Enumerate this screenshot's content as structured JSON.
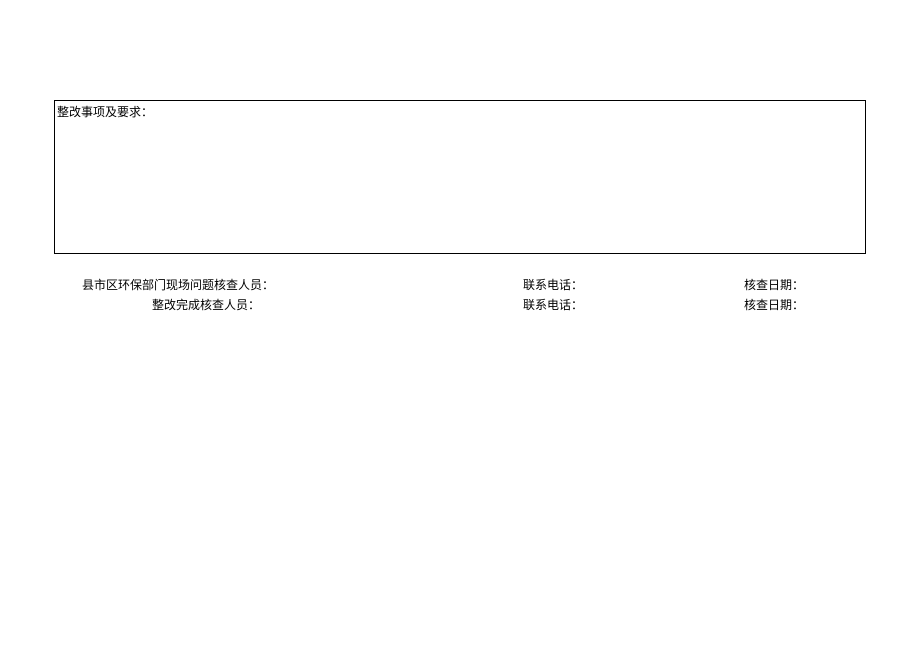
{
  "box": {
    "title": "整改事项及要求："
  },
  "signatures": {
    "row1": {
      "personnel_label": "县市区环保部门现场问题核查人员：",
      "phone_label": "联系电话：",
      "date_label": "核查日期："
    },
    "row2": {
      "personnel_label": "整改完成核查人员：",
      "phone_label": "联系电话：",
      "date_label": "核查日期："
    }
  }
}
